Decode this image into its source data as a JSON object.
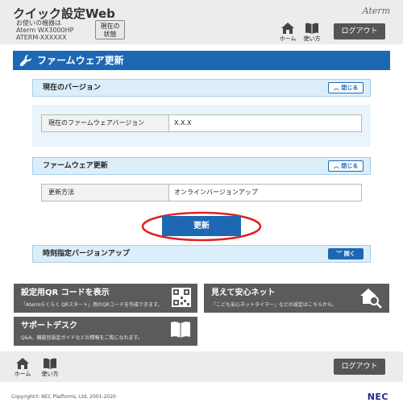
{
  "header": {
    "app_title": "クイック設定Web",
    "device_caption": "お使いの機器は",
    "device_model": "Aterm WX3000HP",
    "device_id": "ATERM-XXXXXX",
    "status_button": "現在の状態",
    "brand": "Aterm",
    "nav_home": "ホーム",
    "nav_howto": "使い方",
    "logout": "ログアウト"
  },
  "page": {
    "title": "ファームウェア更新"
  },
  "sections": {
    "current_version": {
      "title": "現在のバージョン",
      "toggle": "閉じる",
      "row_label": "現在のファームウェアバージョン",
      "row_value": "X.X.X"
    },
    "firmware_update": {
      "title": "ファームウェア更新",
      "toggle": "閉じる",
      "row_label": "更新方法",
      "row_value": "オンラインバージョンアップ"
    },
    "update_button": "更新",
    "scheduled": {
      "title": "時刻指定バージョンアップ",
      "toggle": "開く"
    }
  },
  "tiles": {
    "qr": {
      "title": "設定用QR コードを表示",
      "desc": "「Atermらくらく QRスタート」用のQRコードを作成できます。"
    },
    "safety": {
      "title": "見えて安心ネット",
      "desc": "「こども安心ネットタイマー」などの設定はこちらから。"
    },
    "support": {
      "title": "サポートデスク",
      "desc": "Q&A、機能別設定ガイドなどの情報をご覧になれます。"
    }
  },
  "footer": {
    "nav_home": "ホーム",
    "nav_howto": "使い方",
    "logout": "ログアウト",
    "copyright": "Copyright© NEC Platforms, Ltd. 2001-2020",
    "nec": "NEC"
  },
  "colors": {
    "accent": "#1e68b3",
    "highlight": "#e02020",
    "tile": "#5b5b5b"
  }
}
